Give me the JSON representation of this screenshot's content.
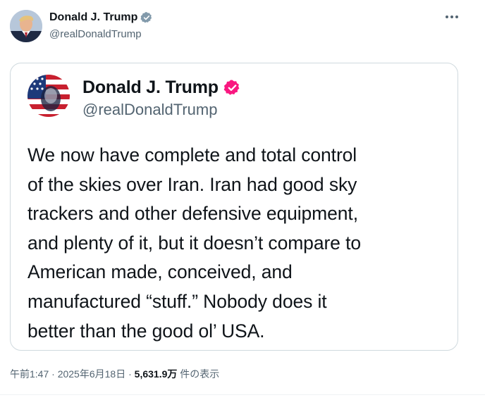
{
  "author": {
    "name": "Donald J. Trump",
    "handle": "@realDonaldTrump",
    "verified": true,
    "badge_color": "#829aab"
  },
  "more_icon": "more-horizontal-icon",
  "quoted_post": {
    "author_name": "Donald J. Trump",
    "author_handle": "@realDonaldTrump",
    "badge_color": "#f91880",
    "body_lines": [
      "We now have complete and total control",
      "of the skies over Iran. Iran had good sky",
      "trackers and other defensive equipment,",
      "and plenty of it, but it doesn’t compare to",
      "American made, conceived, and",
      "manufactured “stuff.” Nobody does it",
      "better than the good ol’ USA."
    ]
  },
  "meta": {
    "time": "午前1:47",
    "separator": " · ",
    "date": "2025年6月18日",
    "views_count": "5,631.9万",
    "views_label": " 件の表示"
  }
}
